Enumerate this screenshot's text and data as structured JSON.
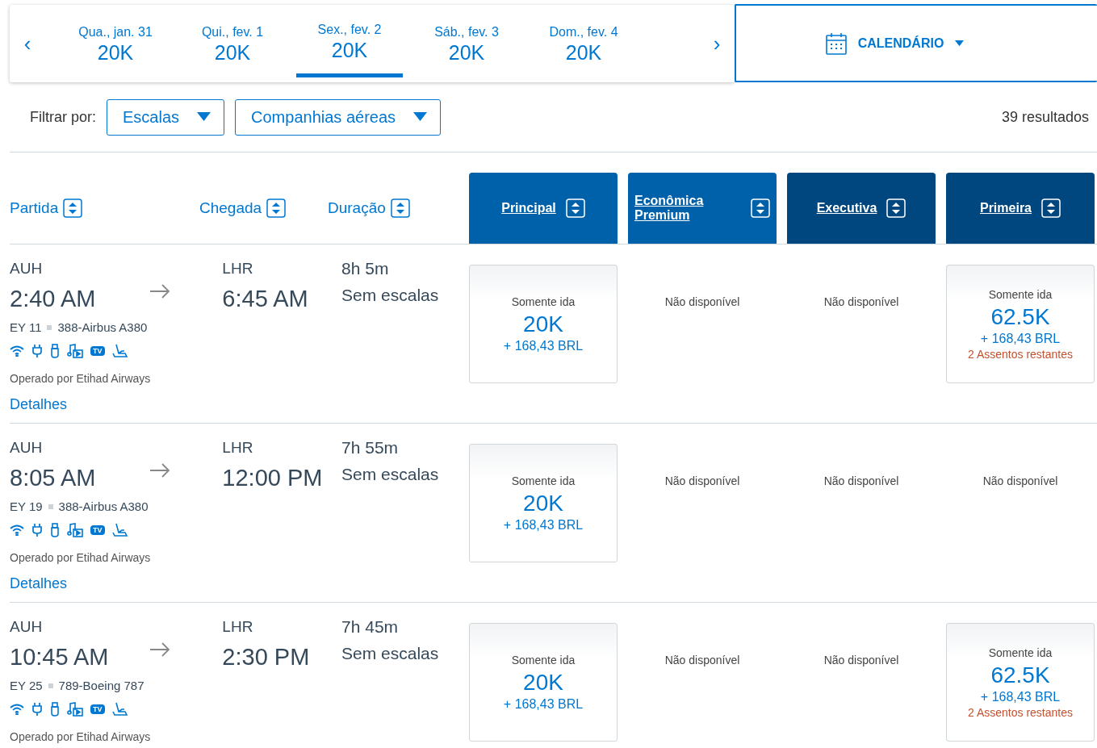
{
  "date_strip": {
    "prev": "‹",
    "next": "›",
    "dates": [
      {
        "label": "Qua., jan. 31",
        "price": "20K",
        "selected": false
      },
      {
        "label": "Qui., fev. 1",
        "price": "20K",
        "selected": false
      },
      {
        "label": "Sex., fev. 2",
        "price": "20K",
        "selected": true
      },
      {
        "label": "Sáb., fev. 3",
        "price": "20K",
        "selected": false
      },
      {
        "label": "Dom., fev. 4",
        "price": "20K",
        "selected": false
      }
    ],
    "calendar": "CALENDÁRIO"
  },
  "filters": {
    "label": "Filtrar por:",
    "dropdowns": [
      "Escalas",
      "Companhias aéreas"
    ],
    "results": "39 resultados"
  },
  "columns": [
    {
      "label": "Partida"
    },
    {
      "label": "Chegada"
    },
    {
      "label": "Duração"
    }
  ],
  "cabins": [
    {
      "label": "Principal",
      "color": "#0061ab"
    },
    {
      "label": "Econômica Premium",
      "color": "#0061ab"
    },
    {
      "label": "Executiva",
      "color": "#00467f"
    },
    {
      "label": "Primeira",
      "color": "#00467f"
    }
  ],
  "flights": [
    {
      "from": "AUH",
      "depart": "2:40 AM",
      "to": "LHR",
      "arrive": "6:45 AM",
      "duration": "8h 5m",
      "stops": "Sem escalas",
      "flight": "EY 11",
      "aircraft": "388-Airbus A380",
      "amenities": [
        {
          "kind": "wifi"
        },
        {
          "kind": "power"
        },
        {
          "kind": "usb"
        },
        {
          "kind": "media"
        },
        {
          "kind": "tv",
          "label": "TV"
        },
        {
          "kind": "seat"
        }
      ],
      "operator": "Operado por Etihad Airways",
      "details": "Detalhes",
      "fares": [
        {
          "kind": "fare",
          "type": "Somente ida",
          "miles": "20K",
          "fee": "+ 168,43 BRL"
        },
        {
          "kind": "unavailable",
          "text": "Não disponível"
        },
        {
          "kind": "unavailable",
          "text": "Não disponível"
        },
        {
          "kind": "fare",
          "type": "Somente ida",
          "miles": "62.5K",
          "fee": "+ 168,43 BRL",
          "seats": "2 Assentos restantes"
        }
      ]
    },
    {
      "from": "AUH",
      "depart": "8:05 AM",
      "to": "LHR",
      "arrive": "12:00 PM",
      "duration": "7h 55m",
      "stops": "Sem escalas",
      "flight": "EY 19",
      "aircraft": "388-Airbus A380",
      "amenities": [
        {
          "kind": "wifi"
        },
        {
          "kind": "power"
        },
        {
          "kind": "usb"
        },
        {
          "kind": "media"
        },
        {
          "kind": "tv",
          "label": "TV"
        },
        {
          "kind": "seat"
        }
      ],
      "operator": "Operado por Etihad Airways",
      "details": "Detalhes",
      "fares": [
        {
          "kind": "fare",
          "type": "Somente ida",
          "miles": "20K",
          "fee": "+ 168,43 BRL"
        },
        {
          "kind": "unavailable",
          "text": "Não disponível"
        },
        {
          "kind": "unavailable",
          "text": "Não disponível"
        },
        {
          "kind": "unavailable",
          "text": "Não disponível"
        }
      ]
    },
    {
      "from": "AUH",
      "depart": "10:45 AM",
      "to": "LHR",
      "arrive": "2:30 PM",
      "duration": "7h 45m",
      "stops": "Sem escalas",
      "flight": "EY 25",
      "aircraft": "789-Boeing 787",
      "amenities": [
        {
          "kind": "wifi"
        },
        {
          "kind": "power"
        },
        {
          "kind": "usb"
        },
        {
          "kind": "media"
        },
        {
          "kind": "tv",
          "label": "TV"
        },
        {
          "kind": "seat"
        }
      ],
      "operator": "Operado por Etihad Airways",
      "fares": [
        {
          "kind": "fare",
          "type": "Somente ida",
          "miles": "20K",
          "fee": "+ 168,43 BRL"
        },
        {
          "kind": "unavailable",
          "text": "Não disponível"
        },
        {
          "kind": "unavailable",
          "text": "Não disponível"
        },
        {
          "kind": "fare",
          "type": "Somente ida",
          "miles": "62.5K",
          "fee": "+ 168,43 BRL",
          "seats": "2 Assentos restantes"
        }
      ]
    }
  ]
}
